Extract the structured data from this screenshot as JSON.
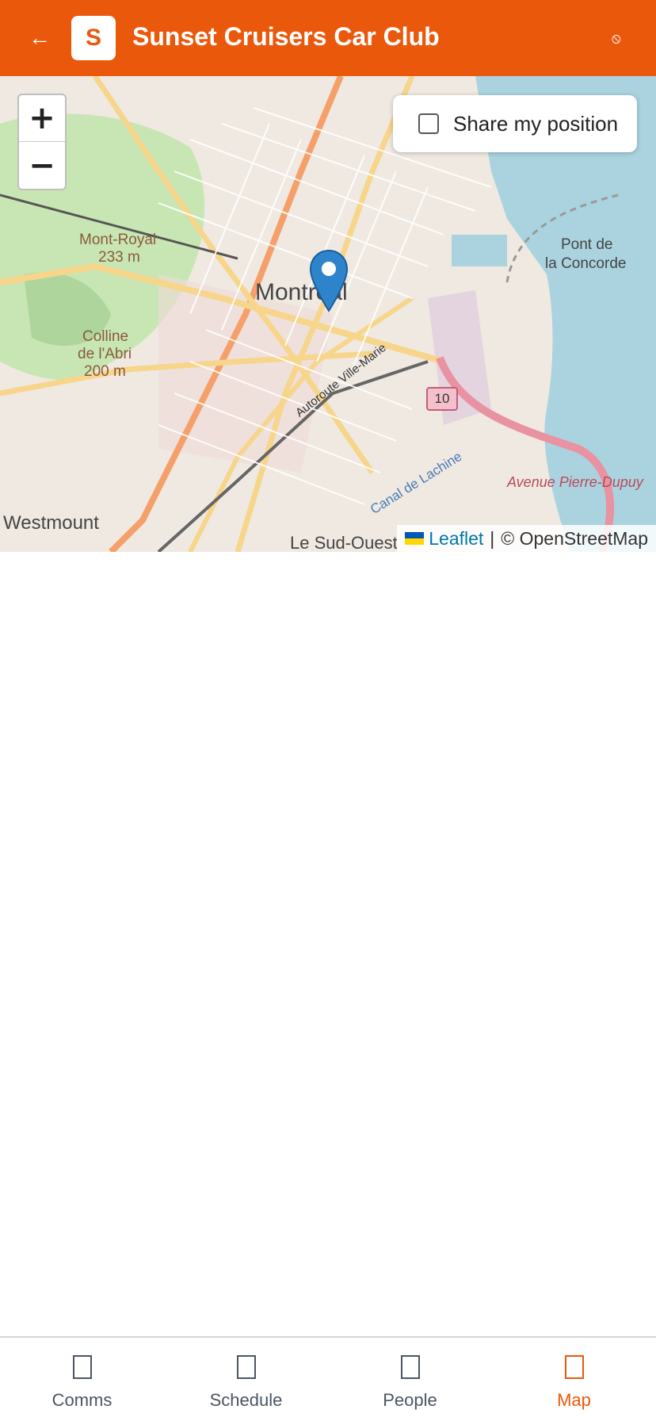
{
  "header": {
    "back_label": "←",
    "logo_letter": "S",
    "title": "Sunset Cruisers Car Club",
    "status_icon": "⦸"
  },
  "map": {
    "zoom_in": "+",
    "zoom_out": "−",
    "share_label": "Share my position",
    "share_checked": false,
    "attribution_link": "Leaflet",
    "attribution_sep": "|",
    "attribution_text": "© OpenStreetMap",
    "labels": {
      "city": "Montréal",
      "mont_royal": "Mont-Royal",
      "mont_royal_elev": "233 m",
      "colline": "Colline",
      "colline2": "de l'Abri",
      "colline_elev": "200 m",
      "pont": "Pont de",
      "pont2": "la Concorde",
      "westmount": "Westmount",
      "sud_ouest": "Le Sud-Ouest",
      "autoroute": "Autoroute Ville-Marie",
      "canal": "Canal de Lachine",
      "avenue": "Avenue Pierre-Dupuy",
      "route10": "10"
    }
  },
  "nav": {
    "items": [
      {
        "label": "Comms",
        "icon": "comms-icon"
      },
      {
        "label": "Schedule",
        "icon": "schedule-icon"
      },
      {
        "label": "People",
        "icon": "people-icon"
      },
      {
        "label": "Map",
        "icon": "map-icon"
      }
    ],
    "active": "Map"
  },
  "colors": {
    "brand": "#ea580c",
    "water": "#aad3df",
    "park": "#c8e6b4",
    "road_major": "#f7d58b"
  }
}
